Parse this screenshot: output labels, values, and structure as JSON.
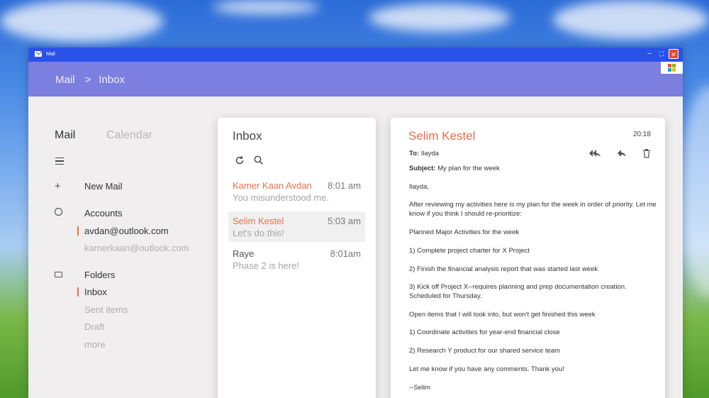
{
  "window": {
    "title": "Mail"
  },
  "breadcrumb": {
    "root": "Mail",
    "separator": ">",
    "current": "Inbox"
  },
  "nav": {
    "tabs": {
      "mail": "Mail",
      "calendar": "Calendar"
    },
    "new_mail": "New Mail",
    "accounts_label": "Accounts",
    "accounts": [
      "avdan@outlook.com",
      "kamerkaan@outlook.com"
    ],
    "folders_label": "Folders",
    "folders": [
      "Inbox",
      "Sent items",
      "Draft",
      "more"
    ]
  },
  "inbox": {
    "title": "Inbox",
    "messages": [
      {
        "sender": "Kamer Kaan Avdan",
        "time": "8:01 am",
        "preview": "You misunderstood me."
      },
      {
        "sender": "Selim Kestel",
        "time": "5:03 am",
        "preview": "Let's do this!"
      },
      {
        "sender": "Raye",
        "time": "8:01am",
        "preview": "Phase 2 is here!"
      }
    ]
  },
  "reader": {
    "from": "Selim Kestel",
    "time": "20:18",
    "to_label": "To:",
    "to": "Ilayda",
    "subject_label": "Subject:",
    "subject": "My plan for the week",
    "body": [
      "Ilayda,",
      "After reviewing my activities here is my plan for the week in order of priority. Let me",
      "know if you think I should re-prioritize:",
      "Planned Major Activities for the week",
      "1) Complete project charter for X Project",
      "2) Finish the financial analysis report that was started last week",
      "3) Kick off Project X--requires planning and prep documentation creation.",
      "Scheduled for Thursday.",
      "Open items that I will look into, but won't get finished this week",
      "1) Coordinate activities for year-end financial close",
      "2) Research Y product for our shared service team",
      "Let me know if you have any comments. Thank you!",
      "--Selim"
    ]
  },
  "colors": {
    "accent": "#e8704c",
    "titlebar": "#2a52e8",
    "header": "#7c7ee0"
  }
}
